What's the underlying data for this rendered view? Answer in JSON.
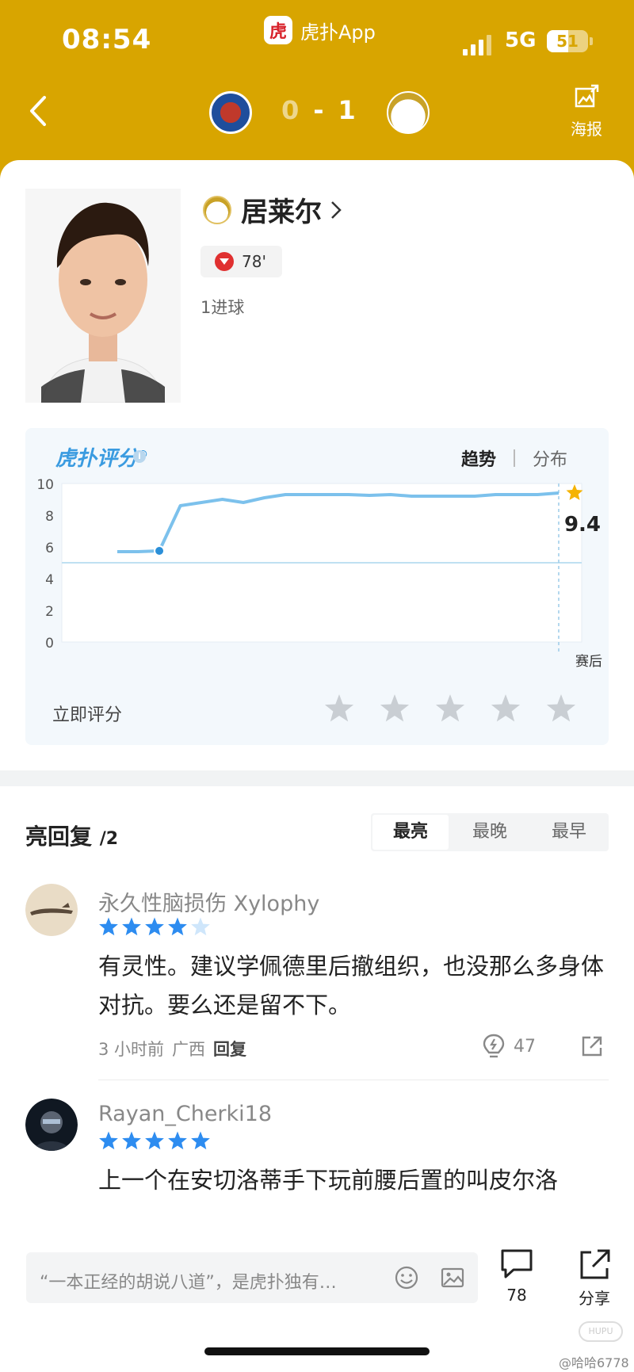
{
  "status_bar": {
    "time": "08:54",
    "network": "5G",
    "battery": "51"
  },
  "app": {
    "logo_text": "虎",
    "name": "虎扑App"
  },
  "match": {
    "home_score": "0",
    "separator": "-",
    "away_score": "1",
    "poster_label": "海报"
  },
  "player": {
    "name": "居莱尔",
    "sub_minute": "78'",
    "goals_text": "1进球"
  },
  "rating": {
    "logo_text": "虎扑评分",
    "logo_mark": "®",
    "tab_trend": "趋势",
    "tab_distribution": "分布",
    "rate_now_label": "立即评分",
    "star_count": 5
  },
  "chart_data": {
    "type": "line",
    "title": "",
    "xlabel": "",
    "ylabel": "",
    "ylim": [
      0,
      10
    ],
    "yticks": [
      0,
      2,
      4,
      6,
      8,
      10
    ],
    "x_end_label": "赛后",
    "final_value": "9.4",
    "baseline": 5,
    "series": [
      {
        "values": [
          5.7,
          5.7,
          5.75,
          8.6,
          8.8,
          9.0,
          8.8,
          9.1,
          9.3,
          9.3,
          9.3,
          9.3,
          9.25,
          9.3,
          9.2,
          9.2,
          9.2,
          9.2,
          9.3,
          9.3,
          9.3,
          9.4
        ]
      }
    ]
  },
  "comments": {
    "title": "亮回复",
    "count": "/2",
    "sort_tabs": [
      "最亮",
      "最晚",
      "最早"
    ],
    "items": [
      {
        "user": "永久性脑损伤 Xylophy",
        "stars": 4,
        "text": "有灵性。建议学佩德里后撤组织，也没那么多身体对抗。要么还是留不下。",
        "time": "3 小时前",
        "region": "广西",
        "reply_label": "回复",
        "likes": "47"
      },
      {
        "user": "Rayan_Cherki18",
        "stars": 5,
        "text": "上一个在安切洛蒂手下玩前腰后置的叫皮尔洛"
      }
    ]
  },
  "bottom_bar": {
    "input_placeholder": "“一本正经的胡说八道”，是虎扑独有…",
    "comment_count": "78",
    "share_label": "分享"
  },
  "watermark": {
    "text": "@哈哈6778",
    "badge": "HUPU"
  },
  "colors": {
    "brand": "#d8a500",
    "accent_blue": "#3a9be0",
    "star_blue": "#2d8cf0",
    "star_gold": "#f5b301"
  }
}
